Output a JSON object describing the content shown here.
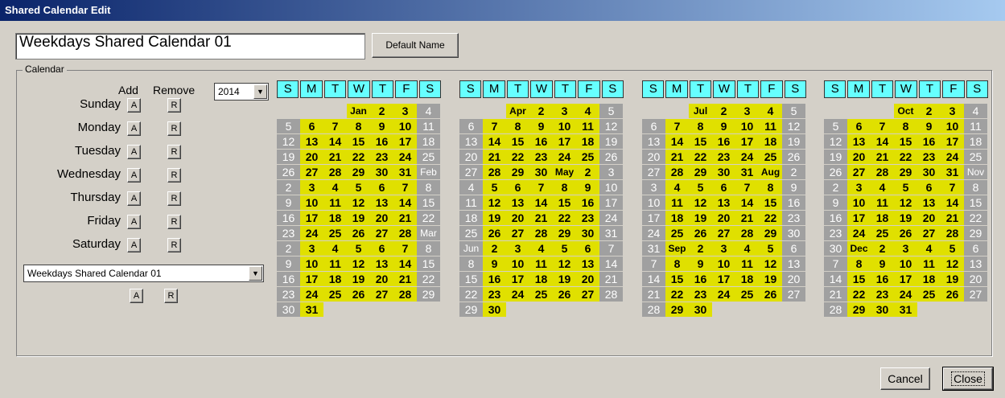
{
  "window": {
    "title": "Shared Calendar Edit"
  },
  "name_field": {
    "value": "Weekdays Shared Calendar 01"
  },
  "default_name_label": "Default Name",
  "group_label": "Calendar",
  "headers": {
    "add": "Add",
    "remove": "Remove"
  },
  "days": [
    "Sunday",
    "Monday",
    "Tuesday",
    "Wednesday",
    "Thursday",
    "Friday",
    "Saturday"
  ],
  "add_btn": "A",
  "remove_btn": "R",
  "year": "2014",
  "calendar_select": "Weekdays Shared Calendar 01",
  "weekday_headers": [
    "S",
    "M",
    "T",
    "W",
    "T",
    "F",
    "S"
  ],
  "buttons": {
    "cancel": "Cancel",
    "close": "Close"
  },
  "colors": {
    "weekday": "#e0e000",
    "weekend": "#a0a0a0",
    "header": "#66ffff"
  },
  "quarters": [
    {
      "weeks": [
        [
          null,
          null,
          null,
          "Jan",
          "2",
          "3",
          "4"
        ],
        [
          "5",
          "6",
          "7",
          "8",
          "9",
          "10",
          "11"
        ],
        [
          "12",
          "13",
          "14",
          "15",
          "16",
          "17",
          "18"
        ],
        [
          "19",
          "20",
          "21",
          "22",
          "23",
          "24",
          "25"
        ],
        [
          "26",
          "27",
          "28",
          "29",
          "30",
          "31",
          "Feb"
        ],
        [
          "2",
          "3",
          "4",
          "5",
          "6",
          "7",
          "8"
        ],
        [
          "9",
          "10",
          "11",
          "12",
          "13",
          "14",
          "15"
        ],
        [
          "16",
          "17",
          "18",
          "19",
          "20",
          "21",
          "22"
        ],
        [
          "23",
          "24",
          "25",
          "26",
          "27",
          "28",
          "Mar"
        ],
        [
          "2",
          "3",
          "4",
          "5",
          "6",
          "7",
          "8"
        ],
        [
          "9",
          "10",
          "11",
          "12",
          "13",
          "14",
          "15"
        ],
        [
          "16",
          "17",
          "18",
          "19",
          "20",
          "21",
          "22"
        ],
        [
          "23",
          "24",
          "25",
          "26",
          "27",
          "28",
          "29"
        ],
        [
          "30",
          "31",
          null,
          null,
          null,
          null,
          null
        ]
      ]
    },
    {
      "weeks": [
        [
          null,
          null,
          null,
          "Apr",
          "2",
          "3",
          "4",
          "5"
        ],
        [
          "6",
          "7",
          "8",
          "9",
          "10",
          "11",
          "12"
        ],
        [
          "13",
          "14",
          "15",
          "16",
          "17",
          "18",
          "19"
        ],
        [
          "20",
          "21",
          "22",
          "23",
          "24",
          "25",
          "26"
        ],
        [
          "27",
          "28",
          "29",
          "30",
          "May",
          "2",
          "3"
        ],
        [
          "4",
          "5",
          "6",
          "7",
          "8",
          "9",
          "10"
        ],
        [
          "11",
          "12",
          "13",
          "14",
          "15",
          "16",
          "17"
        ],
        [
          "18",
          "19",
          "20",
          "21",
          "22",
          "23",
          "24"
        ],
        [
          "25",
          "26",
          "27",
          "28",
          "29",
          "30",
          "31"
        ],
        [
          "Jun",
          "2",
          "3",
          "4",
          "5",
          "6",
          "7"
        ],
        [
          "8",
          "9",
          "10",
          "11",
          "12",
          "13",
          "14"
        ],
        [
          "15",
          "16",
          "17",
          "18",
          "19",
          "20",
          "21"
        ],
        [
          "22",
          "23",
          "24",
          "25",
          "26",
          "27",
          "28"
        ],
        [
          "29",
          "30",
          null,
          null,
          null,
          null,
          null
        ]
      ]
    },
    {
      "weeks": [
        [
          null,
          null,
          null,
          "Jul",
          "2",
          "3",
          "4",
          "5"
        ],
        [
          "6",
          "7",
          "8",
          "9",
          "10",
          "11",
          "12"
        ],
        [
          "13",
          "14",
          "15",
          "16",
          "17",
          "18",
          "19"
        ],
        [
          "20",
          "21",
          "22",
          "23",
          "24",
          "25",
          "26"
        ],
        [
          "27",
          "28",
          "29",
          "30",
          "31",
          "Aug",
          "2"
        ],
        [
          "3",
          "4",
          "5",
          "6",
          "7",
          "8",
          "9"
        ],
        [
          "10",
          "11",
          "12",
          "13",
          "14",
          "15",
          "16"
        ],
        [
          "17",
          "18",
          "19",
          "20",
          "21",
          "22",
          "23"
        ],
        [
          "24",
          "25",
          "26",
          "27",
          "28",
          "29",
          "30"
        ],
        [
          "31",
          "Sep",
          "2",
          "3",
          "4",
          "5",
          "6"
        ],
        [
          "7",
          "8",
          "9",
          "10",
          "11",
          "12",
          "13"
        ],
        [
          "14",
          "15",
          "16",
          "17",
          "18",
          "19",
          "20"
        ],
        [
          "21",
          "22",
          "23",
          "24",
          "25",
          "26",
          "27"
        ],
        [
          "28",
          "29",
          "30",
          null,
          null,
          null,
          null
        ]
      ]
    },
    {
      "weeks": [
        [
          null,
          null,
          null,
          null,
          "Oct",
          "2",
          "3",
          "4"
        ],
        [
          "5",
          "6",
          "7",
          "8",
          "9",
          "10",
          "11"
        ],
        [
          "12",
          "13",
          "14",
          "15",
          "16",
          "17",
          "18"
        ],
        [
          "19",
          "20",
          "21",
          "22",
          "23",
          "24",
          "25"
        ],
        [
          "26",
          "27",
          "28",
          "29",
          "30",
          "31",
          "Nov"
        ],
        [
          "2",
          "3",
          "4",
          "5",
          "6",
          "7",
          "8"
        ],
        [
          "9",
          "10",
          "11",
          "12",
          "13",
          "14",
          "15"
        ],
        [
          "16",
          "17",
          "18",
          "19",
          "20",
          "21",
          "22"
        ],
        [
          "23",
          "24",
          "25",
          "26",
          "27",
          "28",
          "29"
        ],
        [
          "30",
          "Dec",
          "2",
          "3",
          "4",
          "5",
          "6"
        ],
        [
          "7",
          "8",
          "9",
          "10",
          "11",
          "12",
          "13"
        ],
        [
          "14",
          "15",
          "16",
          "17",
          "18",
          "19",
          "20"
        ],
        [
          "21",
          "22",
          "23",
          "24",
          "25",
          "26",
          "27"
        ],
        [
          "28",
          "29",
          "30",
          "31",
          null,
          null,
          null
        ]
      ]
    }
  ]
}
